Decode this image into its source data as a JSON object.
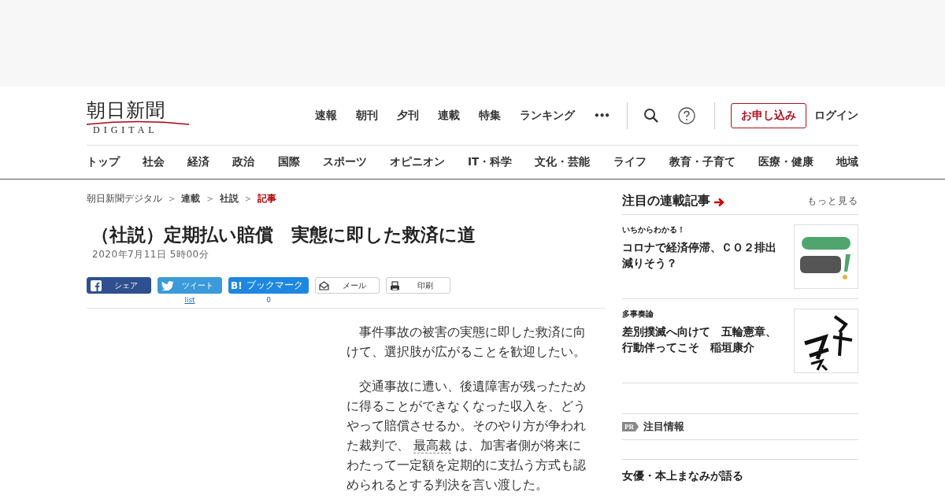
{
  "logo": {
    "title": "朝日新聞",
    "subtitle": "DIGITAL"
  },
  "top_nav": [
    "速報",
    "朝刊",
    "夕刊",
    "連載",
    "特集",
    "ランキング"
  ],
  "more_menu": "•••",
  "subscribe_button": "お申し込み",
  "login_link": "ログイン",
  "category_nav": [
    "トップ",
    "社会",
    "経済",
    "政治",
    "国際",
    "スポーツ",
    "オピニオン",
    "IT・科学",
    "文化・芸能",
    "ライフ",
    "教育・子育て",
    "医療・健康",
    "地域"
  ],
  "breadcrumbs": [
    {
      "label": "朝日新聞デジタル",
      "kind": "plain"
    },
    {
      "label": "連載",
      "kind": "bold"
    },
    {
      "label": "社説",
      "kind": "bold"
    },
    {
      "label": "記事",
      "kind": "current"
    }
  ],
  "breadcrumb_separator": ">",
  "article": {
    "title": "（社説）定期払い賠償　実態に即した救済に道",
    "date": "2020年7月11日 5時00分",
    "share_buttons": [
      {
        "kind": "facebook",
        "label": "シェア"
      },
      {
        "kind": "twitter",
        "label": "ツイート",
        "count": "list"
      },
      {
        "kind": "hatena",
        "label": "ブックマーク",
        "icon_text": "B!",
        "count": "0"
      },
      {
        "kind": "mail",
        "label": "メール"
      },
      {
        "kind": "print",
        "label": "印刷"
      }
    ],
    "paragraphs": [
      [
        {
          "kind": "text",
          "text": "　事件事故の被害の実態に即した救済に向けて、選択肢が広がることを歓迎したい。"
        }
      ],
      [
        {
          "kind": "text",
          "text": "　交通事故に遭い、後遺障害が残ったために得ることができなくなった収入を、どうやって賠償させるか。そのやり方が争われた裁判で、 "
        },
        {
          "kind": "link",
          "text": "最高裁"
        },
        {
          "kind": "text",
          "text": " は、加害者側が将来にわたって一定額を定期的に支払う方式も認められるとする判決を言い渡した。"
        }
      ]
    ]
  },
  "sidebar": {
    "heading": "注目の連載記事",
    "more_link": "もっと見る",
    "items": [
      {
        "series": "いちからわかる！",
        "title": "コロナで経済停滞、ＣＯ２排出減りそう？"
      },
      {
        "series": "多事奏論",
        "title": "差別撲滅へ向けて　五輪憲章、行動伴ってこそ　稲垣康介"
      }
    ],
    "pr_badge": "PR",
    "pr_heading": "注目情報",
    "featured_title": "女優・本上まなみが語る"
  }
}
